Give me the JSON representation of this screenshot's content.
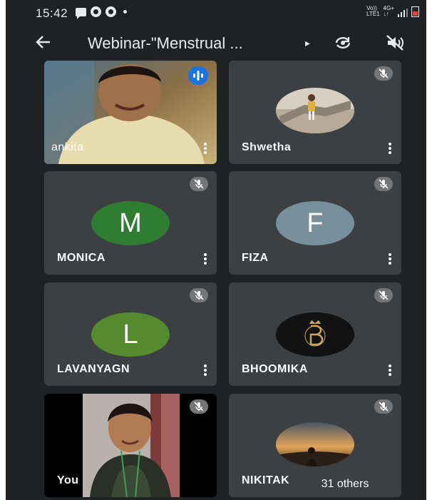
{
  "status_bar": {
    "time": "15:42",
    "net_left": "Vo))",
    "net_left2": "LTE1",
    "net_right": "4G+",
    "net_right2": "↓↑"
  },
  "header": {
    "back_icon": "arrow-back-icon",
    "title": "Webinar-\"Menstrual ...",
    "caret": "▸",
    "rotate_icon": "switch-camera-icon",
    "speaker_icon": "speaker-off-icon"
  },
  "participants": [
    {
      "name": "ankita",
      "kind": "video",
      "speaking": true
    },
    {
      "name": "Shwetha",
      "kind": "photo",
      "muted": true
    },
    {
      "name": "MONICA",
      "kind": "letter",
      "letter": "M",
      "color": "#2e7d32",
      "muted": true
    },
    {
      "name": "FIZA",
      "kind": "letter",
      "letter": "F",
      "color": "#78909c",
      "muted": true
    },
    {
      "name": "LAVANYAGN",
      "kind": "letter",
      "letter": "L",
      "color": "#558b2f",
      "muted": true
    },
    {
      "name": "BHOOMIKA",
      "kind": "photo",
      "muted": true
    },
    {
      "name": "You",
      "kind": "video",
      "muted": true
    },
    {
      "name": "NIKITAK",
      "kind": "photo",
      "muted": true
    }
  ],
  "others_label": "31 others",
  "colors": {
    "background": "#202124",
    "tile": "#3c4043",
    "accent": "#1a73e8"
  }
}
